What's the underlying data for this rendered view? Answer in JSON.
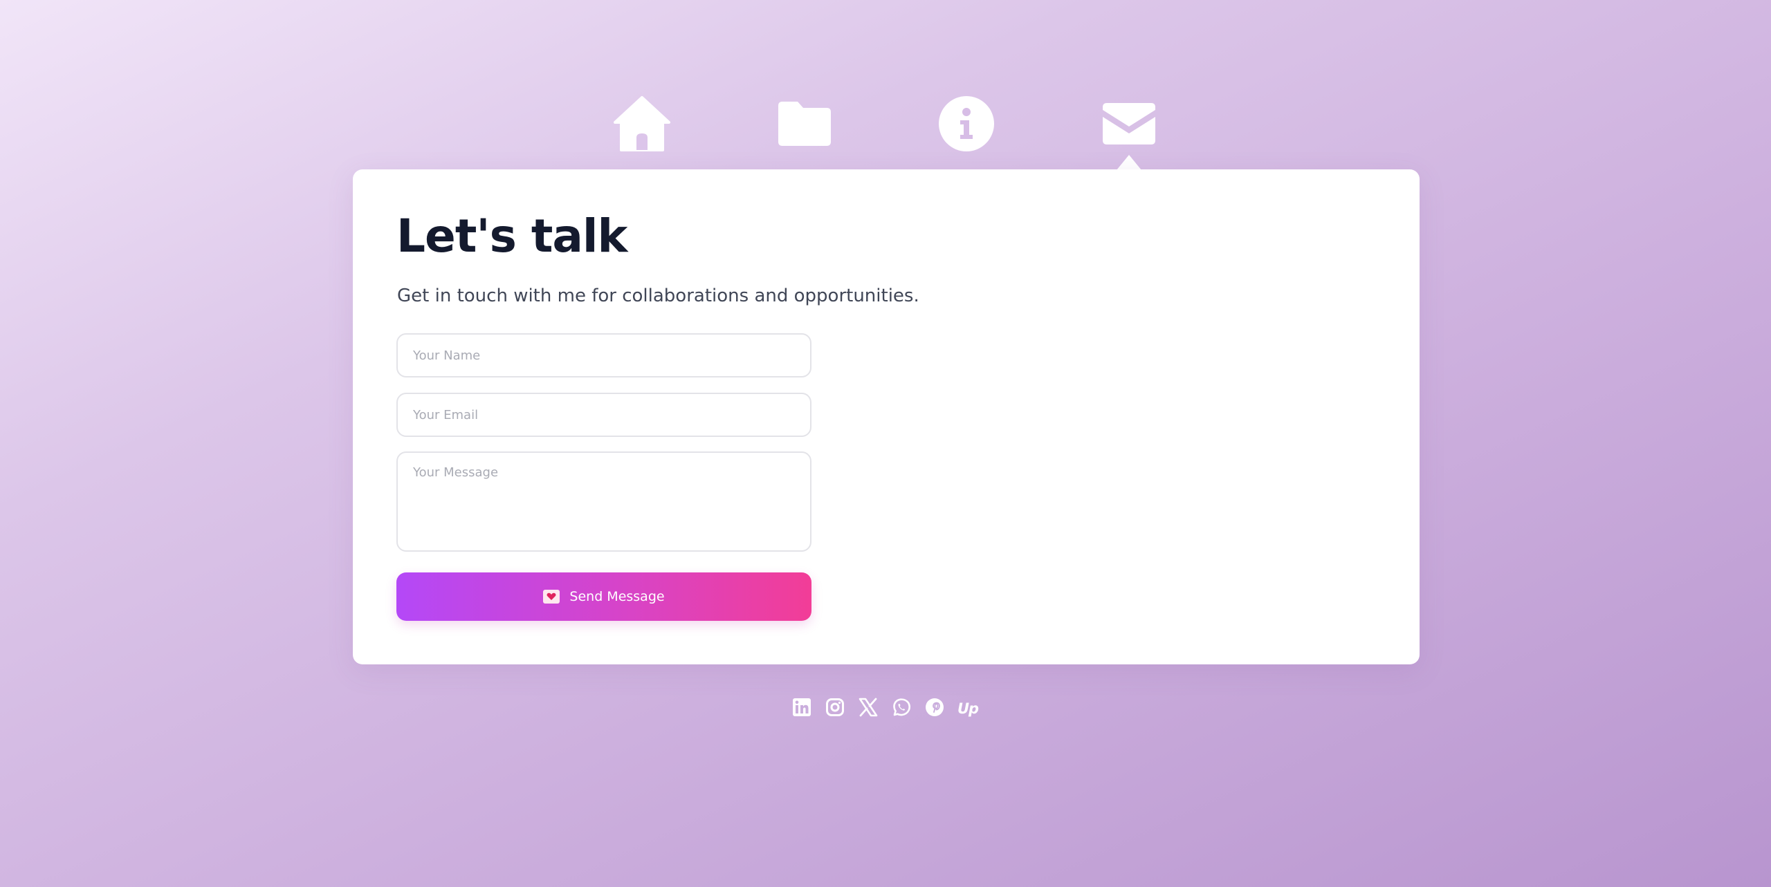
{
  "nav": {
    "items": [
      {
        "icon": "home-icon"
      },
      {
        "icon": "folder-icon"
      },
      {
        "icon": "info-icon"
      },
      {
        "icon": "mail-icon",
        "active": true
      }
    ]
  },
  "contact": {
    "title": "Let's talk",
    "subtitle": "Get in touch with me for collaborations and opportunities.",
    "name_placeholder": "Your Name",
    "email_placeholder": "Your Email",
    "message_placeholder": "Your Message",
    "send_label": "Send Message",
    "send_icon": "love-letter-icon"
  },
  "social": {
    "items": [
      {
        "icon": "linkedin-icon"
      },
      {
        "icon": "instagram-icon"
      },
      {
        "icon": "x-icon"
      },
      {
        "icon": "whatsapp-icon"
      },
      {
        "icon": "pinterest-icon"
      },
      {
        "icon": "upwork-icon",
        "text": "Up"
      }
    ]
  },
  "colors": {
    "background_start": "#f1e5f8",
    "background_end": "#b895cf",
    "title": "#141a2e",
    "button_start": "#b448f7",
    "button_end": "#f23d97"
  }
}
